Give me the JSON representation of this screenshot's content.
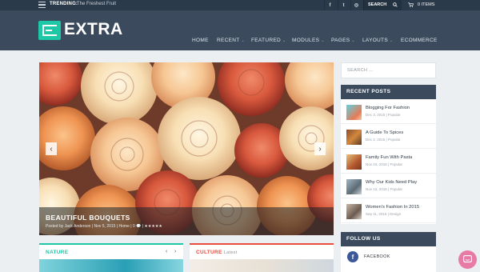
{
  "topbar": {
    "trending_label": "TRENDING:",
    "trending_text": "The Freshest Fruit",
    "social_icons": [
      "facebook-icon",
      "twitter-icon",
      "instagram-icon"
    ],
    "social_glyphs": [
      "f",
      "t",
      "◎"
    ],
    "search_label": "SEARCH",
    "cart_label": "0 ITEMS"
  },
  "header": {
    "logo_text": "EXTRA",
    "accent_color": "#1ec7a6",
    "nav": [
      {
        "label": "HOME",
        "has_dropdown": false
      },
      {
        "label": "RECENT",
        "has_dropdown": true
      },
      {
        "label": "FEATURED",
        "has_dropdown": true
      },
      {
        "label": "MODULES",
        "has_dropdown": true
      },
      {
        "label": "PAGES",
        "has_dropdown": true
      },
      {
        "label": "LAYOUTS",
        "has_dropdown": true
      },
      {
        "label": "ECOMMERCE",
        "has_dropdown": false
      }
    ]
  },
  "slider": {
    "title": "BEAUTIFUL BOUQUETS",
    "meta": "Posted by Jack Anderson | Nov 5, 2015 | Home | 0 💬 | ★★★★★",
    "prev_glyph": "‹",
    "next_glyph": "›"
  },
  "tiles": [
    {
      "label": "NATURE",
      "sub": "",
      "color": "#1ec7a6"
    },
    {
      "label": "CULTURE",
      "sub": "Latest",
      "color": "#e74c3c"
    }
  ],
  "sidebar": {
    "search_placeholder": "SEARCH ...",
    "recent_posts_title": "RECENT POSTS",
    "posts": [
      {
        "title": "Blogging For Fashion",
        "meta": "Dec 3, 2015 | Popular"
      },
      {
        "title": "A Guide To Spices",
        "meta": "Dec 2, 2015 | Popular"
      },
      {
        "title": "Family Fun With Pasta",
        "meta": "Nov 23, 2015 | Popular"
      },
      {
        "title": "Why Our Kids Need Play",
        "meta": "Nov 13, 2015 | Popular"
      },
      {
        "title": "Women's Fashion In 2015",
        "meta": "Sep 11, 2015 | Design"
      }
    ],
    "follow_title": "FOLLOW US",
    "follow_items": [
      {
        "label": "FACEBOOK",
        "icon": "facebook-icon"
      }
    ]
  },
  "chat": {
    "icon": "chat-icon"
  }
}
